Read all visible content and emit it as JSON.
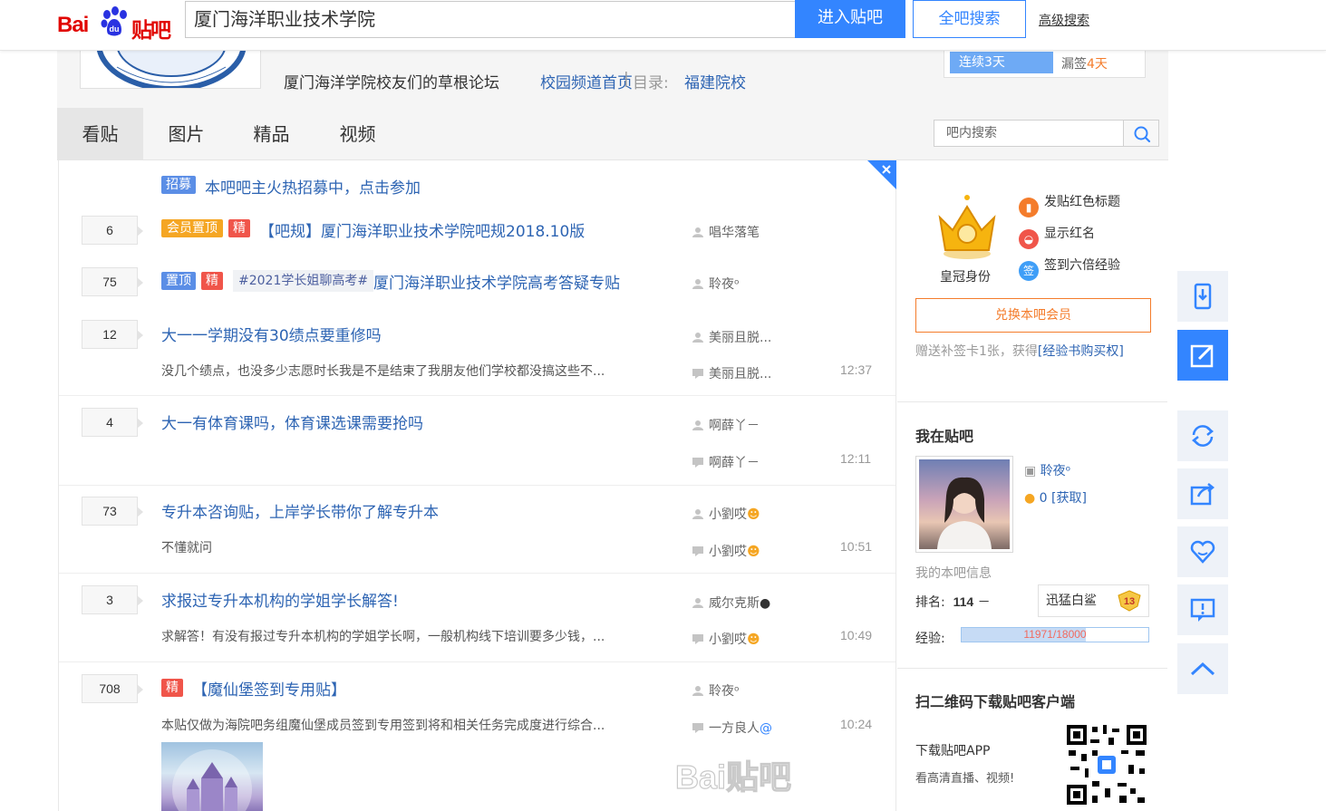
{
  "topbar": {
    "logo_bai": "Bai",
    "logo_du": "du",
    "logo_tieba": "贴吧",
    "search_value": "厦门海洋职业技术学院",
    "enter_label": "进入贴吧",
    "all_search_label": "全吧搜索",
    "advanced_label": "高级搜索"
  },
  "header": {
    "description": "厦门海洋学院校友们的草根论坛",
    "campus_link": "校园频道首页",
    "separator": "|",
    "dir_label": "目录:",
    "dir_link": "福建院校",
    "sign_continuous": "连续3天",
    "sign_miss_prefix": "漏签",
    "sign_miss_days": "4天"
  },
  "tabs": [
    {
      "label": "看贴"
    },
    {
      "label": "图片"
    },
    {
      "label": "精品"
    },
    {
      "label": "视频"
    }
  ],
  "inbar_search": {
    "placeholder": "吧内搜索"
  },
  "threads": {
    "recruit": {
      "tag": "招募",
      "title": "本吧吧主火热招募中，点击参加"
    },
    "t1": {
      "count": "6",
      "tag1": "会员置顶",
      "tag2": "精",
      "title": "【吧规】厦门海洋职业技术学院吧规2018.10版",
      "author": "唱华落笔"
    },
    "t2": {
      "count": "75",
      "tag1": "置顶",
      "tag2": "精",
      "hashtag": "#2021学长姐聊高考#",
      "title": "厦门海洋职业技术学院高考答疑专贴",
      "author": "聆夜ᵒ"
    },
    "t3": {
      "count": "12",
      "title": "大一一学期没有30绩点要重修吗",
      "abstract": "没几个绩点，也没多少志愿时长我是不是结束了我朋友他们学校都没搞这些不...",
      "author": "美丽且脱...",
      "replier": "美丽且脱...",
      "time": "12:37"
    },
    "t4": {
      "count": "4",
      "title": "大一有体育课吗，体育课选课需要抢吗",
      "author": "啊薛丫－",
      "replier": "啊薛丫－",
      "time": "12:11"
    },
    "t5": {
      "count": "73",
      "title": "专升本咨询贴，上岸学长带你了解专升本",
      "abstract": "不懂就问",
      "author": "小劉哎",
      "replier": "小劉哎",
      "time": "10:51"
    },
    "t6": {
      "count": "3",
      "title": "求报过专升本机构的学姐学长解答!",
      "abstract": "求解答！有没有报过专升本机构的学姐学长啊，一般机构线下培训要多少钱，...",
      "author": "威尔克斯",
      "replier": "小劉哎",
      "time": "10:49"
    },
    "t7": {
      "count": "708",
      "tag": "精",
      "title": "【魔仙堡签到专用贴】",
      "abstract": "本贴仅做为海院吧务组魔仙堡成员签到专用签到将和相关任务完成度进行综合...",
      "author": "聆夜ᵒ",
      "replier": "一方良人",
      "time": "10:24"
    }
  },
  "member": {
    "crown_label": "皇冠身份",
    "perk1": "发贴红色标题",
    "perk2": "显示红名",
    "perk3": "签到六倍经验",
    "perk3_icon_text": "签",
    "vip_button": "兑换本吧会员",
    "vip_note": "赠送补签卡1张，获得",
    "vip_note_link": "[经验书购买权]"
  },
  "me": {
    "title": "我在贴吧",
    "username": "聆夜ᵒ",
    "tdou": "0",
    "tdou_link": "[获取]",
    "myinfo": "我的本吧信息",
    "rank_label": "排名:",
    "rank_value": "114",
    "rank_trend": "－",
    "level_name": "迅猛白鲨",
    "level_num": "13",
    "exp_label": "经验:",
    "exp_text": "11971/18000",
    "exp_fraction": 0.665
  },
  "download": {
    "title": "扫二维码下载贴吧客户端",
    "label": "下载贴吧APP",
    "sub": "看高清直播、视频!"
  },
  "watermark": {
    "text": "Bai贴吧"
  },
  "colors": {
    "brand_red": "#e10601",
    "primary_blue": "#3385ff",
    "link_blue": "#2d64b3",
    "vip_orange": "#f47c2b"
  }
}
